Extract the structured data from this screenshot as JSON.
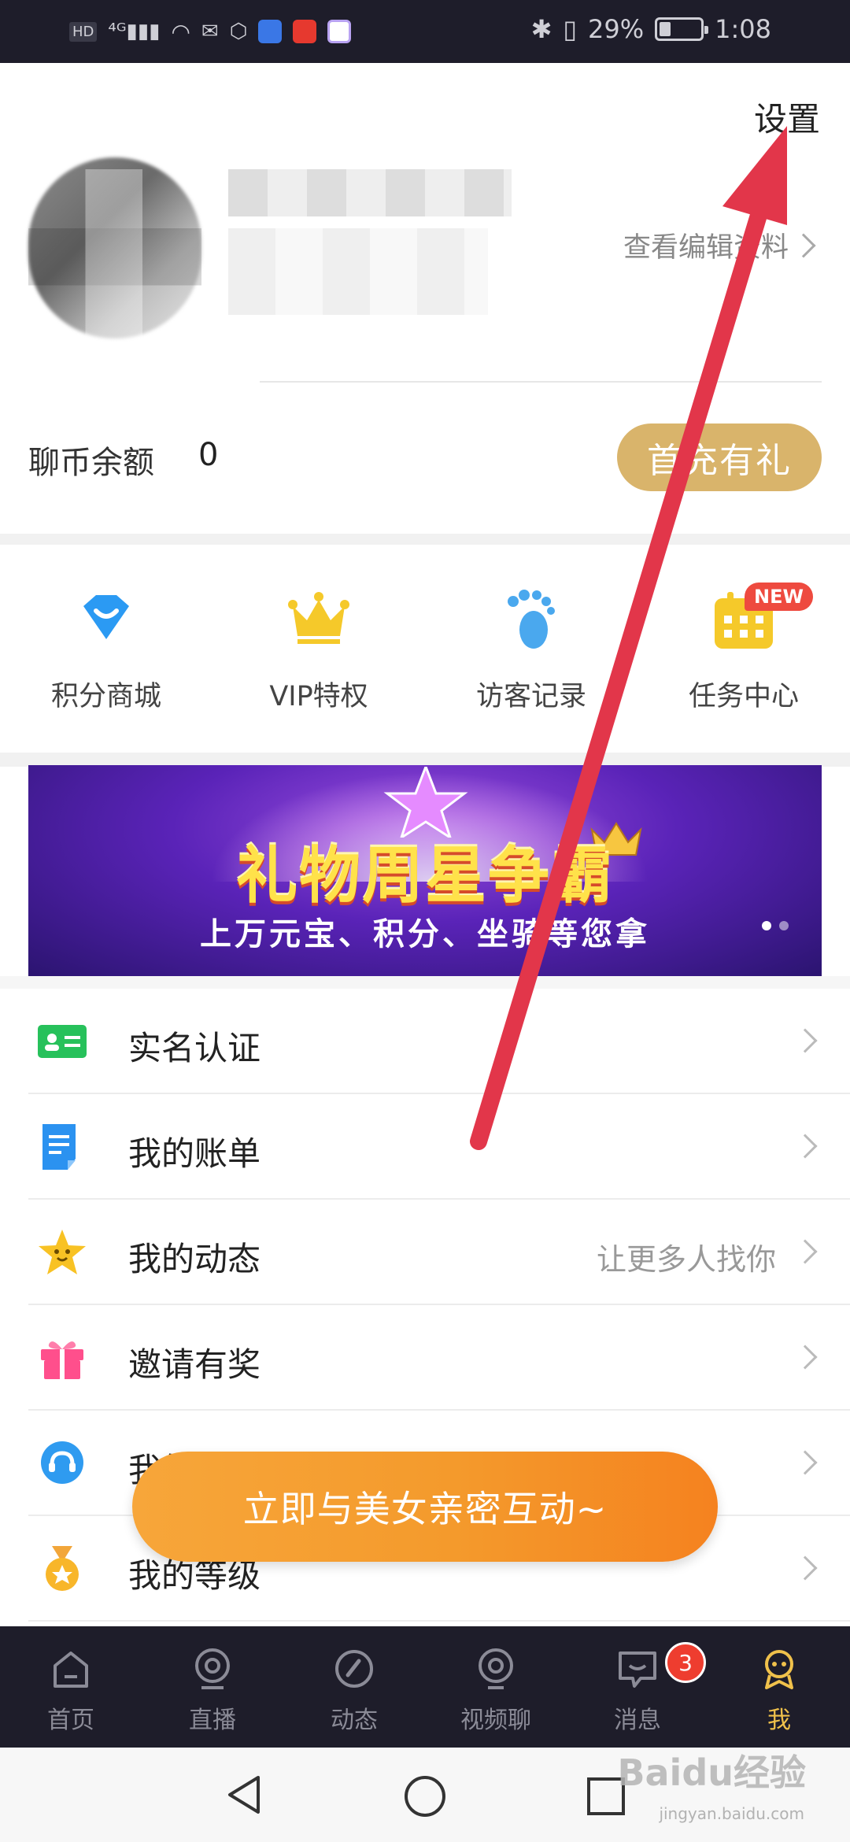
{
  "status_bar": {
    "left_chip": "HD",
    "signal": "⁴ᴳ▮▮▮",
    "battery_pct": "29%",
    "time": "1:08",
    "battery_level": 0.29
  },
  "header": {
    "settings_label": "设置",
    "edit_profile_label": "查看编辑资料"
  },
  "balance": {
    "label": "聊币余额",
    "value": "0",
    "recharge_label": "首充有礼"
  },
  "quick_actions": [
    {
      "label": "积分商城",
      "icon": "shop-bag-icon",
      "color": "#2b9af3"
    },
    {
      "label": "VIP特权",
      "icon": "crown-icon",
      "color": "#f5c92a"
    },
    {
      "label": "访客记录",
      "icon": "footprint-icon",
      "color": "#4aa8ee"
    },
    {
      "label": "任务中心",
      "icon": "calendar-icon",
      "color": "#f5c92a",
      "badge": "NEW"
    }
  ],
  "banner": {
    "title": "礼物周星争霸",
    "subtitle": "上万元宝、积分、坐骑等您拿"
  },
  "menu": [
    {
      "label": "实名认证",
      "icon": "id-card-icon",
      "hint": ""
    },
    {
      "label": "我的账单",
      "icon": "bill-icon",
      "hint": ""
    },
    {
      "label": "我的动态",
      "icon": "star-icon",
      "hint": "让更多人找你"
    },
    {
      "label": "邀请有奖",
      "icon": "gift-icon",
      "hint": ""
    },
    {
      "label": "我的客服",
      "icon": "service-icon",
      "hint": ""
    },
    {
      "label": "我的等级",
      "icon": "medal-icon",
      "hint": ""
    }
  ],
  "promo": {
    "label": "立即与美女亲密互动~"
  },
  "bottom_nav": [
    {
      "label": "首页",
      "icon": "home-icon"
    },
    {
      "label": "直播",
      "icon": "live-icon"
    },
    {
      "label": "动态",
      "icon": "moments-icon"
    },
    {
      "label": "视频聊",
      "icon": "video-chat-icon"
    },
    {
      "label": "消息",
      "icon": "message-icon",
      "badge": "3"
    },
    {
      "label": "我",
      "icon": "profile-icon",
      "active": true
    }
  ],
  "watermark": {
    "brand": "Baidu经验",
    "url": "jingyan.baidu.com"
  },
  "colors": {
    "dark_bar": "#1e1d2a",
    "gold": "#d9b46b",
    "active_nav": "#f0c14b",
    "promo": "#f5821f",
    "arrow": "#e2364a"
  }
}
